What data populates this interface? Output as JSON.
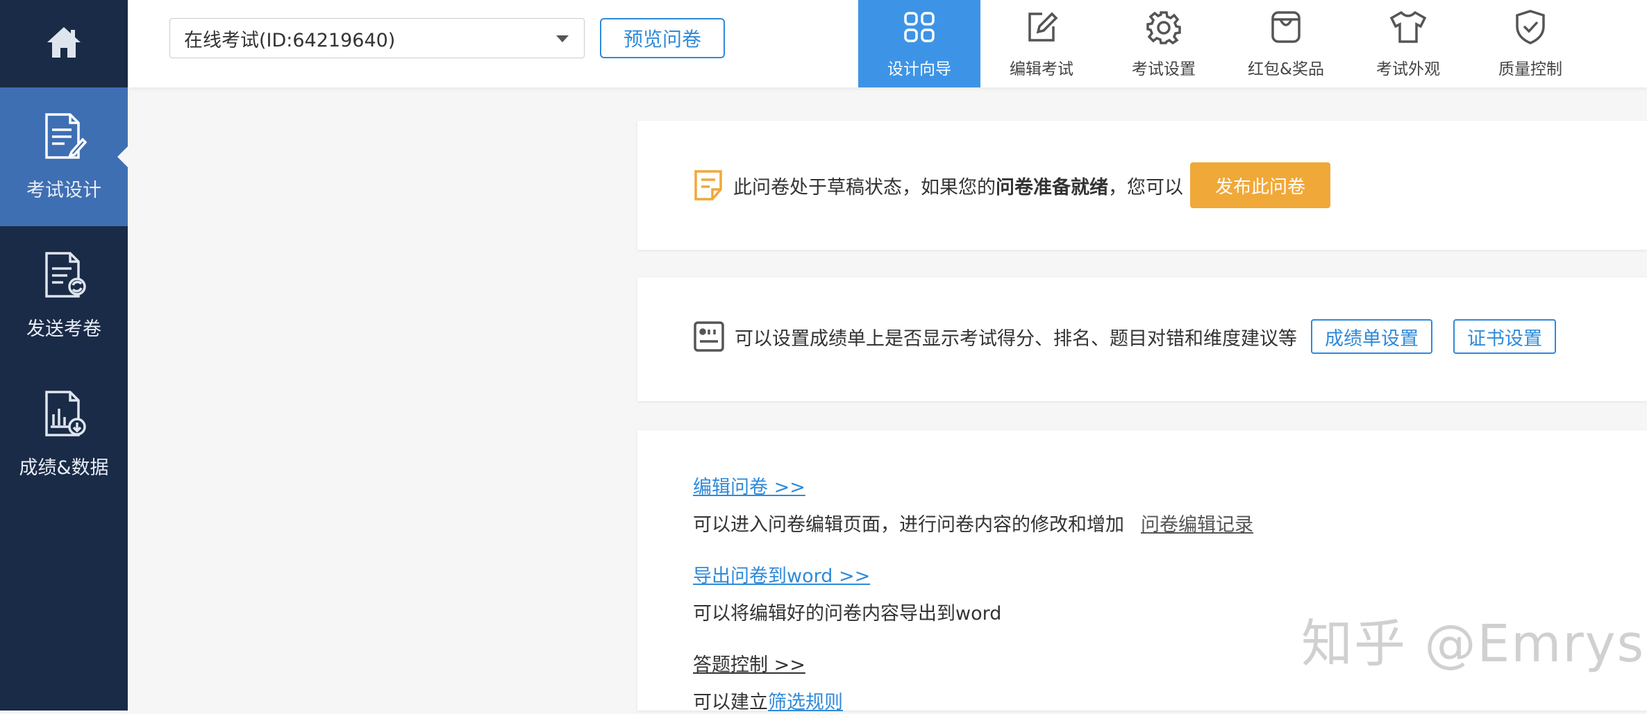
{
  "sidebar": {
    "home_icon": "home-icon",
    "items": [
      {
        "label": "考试设计",
        "icon": "exam-design-icon",
        "active": true
      },
      {
        "label": "发送考卷",
        "icon": "send-paper-icon",
        "active": false
      },
      {
        "label": "成绩&数据",
        "icon": "score-data-icon",
        "active": false
      }
    ]
  },
  "topbar": {
    "survey_select": {
      "value": "在线考试(ID:64219640)"
    },
    "preview_label": "预览问卷",
    "tabs": [
      {
        "label": "设计向导",
        "icon": "grid-icon",
        "active": true
      },
      {
        "label": "编辑考试",
        "icon": "edit-icon",
        "active": false
      },
      {
        "label": "考试设置",
        "icon": "gear-icon",
        "active": false
      },
      {
        "label": "红包&奖品",
        "icon": "gift-bag-icon",
        "active": false
      },
      {
        "label": "考试外观",
        "icon": "tshirt-icon",
        "active": false
      },
      {
        "label": "质量控制",
        "icon": "shield-icon",
        "active": false
      }
    ]
  },
  "draft_notice": {
    "text_before": "此问卷处于草稿状态，如果您的",
    "text_bold": "问卷准备就绪",
    "text_after": "，您可以",
    "publish_label": "发布此问卷"
  },
  "score_settings": {
    "text": "可以设置成绩单上是否显示考试得分、排名、题目对错和维度建议等",
    "scorecard_label": "成绩单设置",
    "certificate_label": "证书设置"
  },
  "actions": {
    "edit_link": "编辑问卷 >>",
    "edit_desc": "可以进入问卷编辑页面，进行问卷内容的修改和增加",
    "edit_history_link": "问卷编辑记录",
    "export_link": "导出问卷到word >>",
    "export_desc": "可以将编辑好的问卷内容导出到word",
    "answer_control_link": "答题控制 >>",
    "answer_control_desc_prefix": "可以建立",
    "filter_rules_link": "筛选规则"
  },
  "watermark": "知乎 @Emrys",
  "colors": {
    "sidebar_bg": "#1a2b47",
    "sidebar_active": "#3f6fb3",
    "tab_active": "#3d94e6",
    "accent_blue": "#2f8ad8",
    "publish_orange": "#f0a838"
  }
}
